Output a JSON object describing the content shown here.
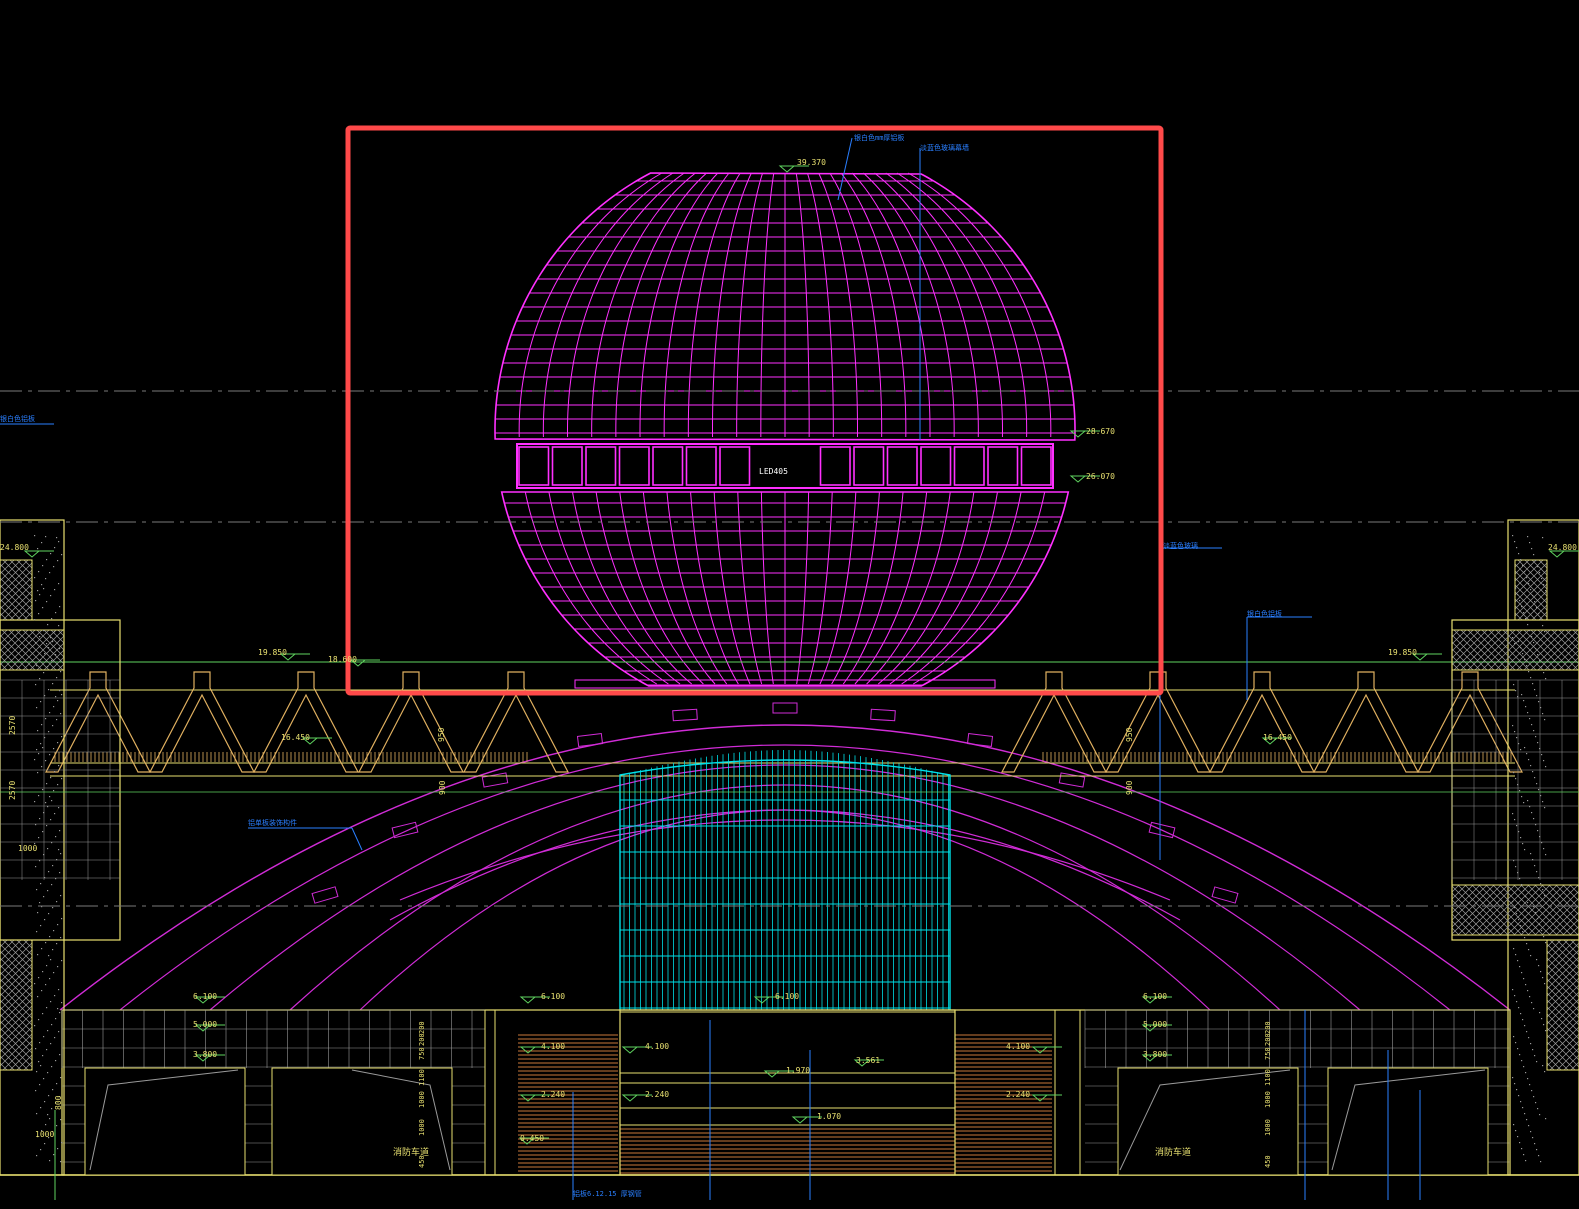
{
  "drawing": {
    "colors": {
      "background": "#000000",
      "globe": "#ff30ff",
      "arch": "#d02cd6",
      "structure": "#e8e070",
      "truss": "#e0b060",
      "glass": "#00e0e8",
      "leader": "#2a7fff",
      "level_marker": "#5fd35f",
      "center_line": "#7a7a7a",
      "hatch": "#9a9a9a",
      "highlight": "#ff4a4a",
      "wood": "#c8783a"
    },
    "levels": {
      "globe_top": "39.370",
      "belt_top": "28.670",
      "belt_bottom": "26.070",
      "roof_left": "19.850",
      "roof_mid": "18.600",
      "roof_right": "19.850",
      "truss_left": "16.450",
      "truss_right": "16.450",
      "level_6100_a": "6.100",
      "level_6100_b": "6.100",
      "level_6100_c": "6.100",
      "level_6100_d": "6.100",
      "level_5000_left": "5.000",
      "level_5000_right": "5.000",
      "level_3800_left": "3.800",
      "level_3800_right": "3.800",
      "level_4100_left": "4.100",
      "level_4100_mid": "4.100",
      "level_4100_right": "4.100",
      "level_3561": "3.561",
      "level_1970": "1.970",
      "level_2240_left": "2.240",
      "level_2240_mid": "2.240",
      "level_2240_right": "2.240",
      "level_1070": "1.070",
      "level_0450": "0.450",
      "left_edge_top": "24.800",
      "right_edge_top": "24.800"
    },
    "center_label": "LED405",
    "dimensions": {
      "truss_height_left": "950",
      "truss_height_right": "950",
      "arch_left": "900",
      "arch_right": "900",
      "left_a": "2570",
      "left_b": "2570",
      "left_c": "1000",
      "left_bottom": "800",
      "left_bottom_b": "1000",
      "stack_left": [
        "200",
        "200",
        "750",
        "1100",
        "1000",
        "1000",
        "450"
      ],
      "stack_right": [
        "200",
        "200",
        "750",
        "1100",
        "1000",
        "1000",
        "450"
      ]
    },
    "notes": {
      "globe_top": "银白色mm厚铝板",
      "globe_side": "淡蓝色玻璃幕墙",
      "left_note": "银白色铝板",
      "arch_note": "铝单板装饰构件",
      "right_note_a": "淡蓝色玻璃",
      "right_note_b": "银白色铝板",
      "bottom_note": "铝板6.12.15 厚钢管",
      "room_left": "消防车道",
      "room_right": "消防车道"
    }
  }
}
